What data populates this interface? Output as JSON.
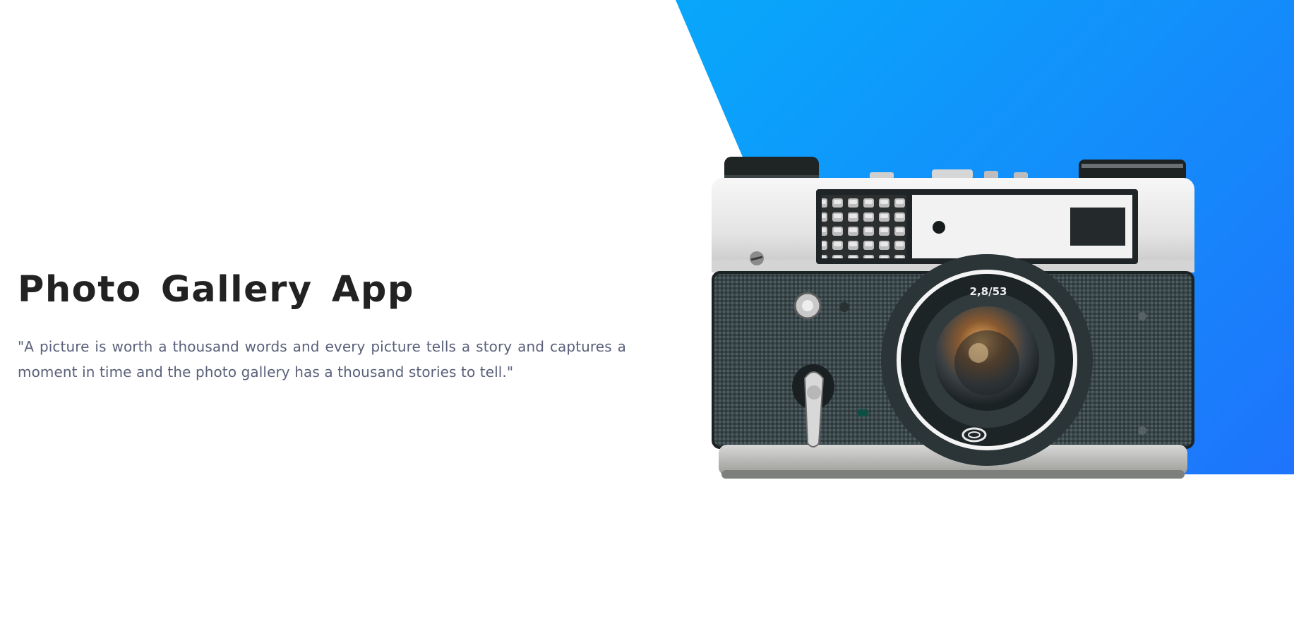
{
  "hero": {
    "title": "Photo Gallery App",
    "quote": "\"A picture is worth a thousand words and every picture tells a story and captures a moment in time and the photo gallery has a thousand stories to tell.\""
  },
  "camera": {
    "icon": "camera-illustration",
    "lens_marking": "2,8/53"
  },
  "colors": {
    "gradient_start": "#00b8fb",
    "gradient_end": "#1e74fb",
    "title": "#222222",
    "body_text": "#5a6079"
  }
}
